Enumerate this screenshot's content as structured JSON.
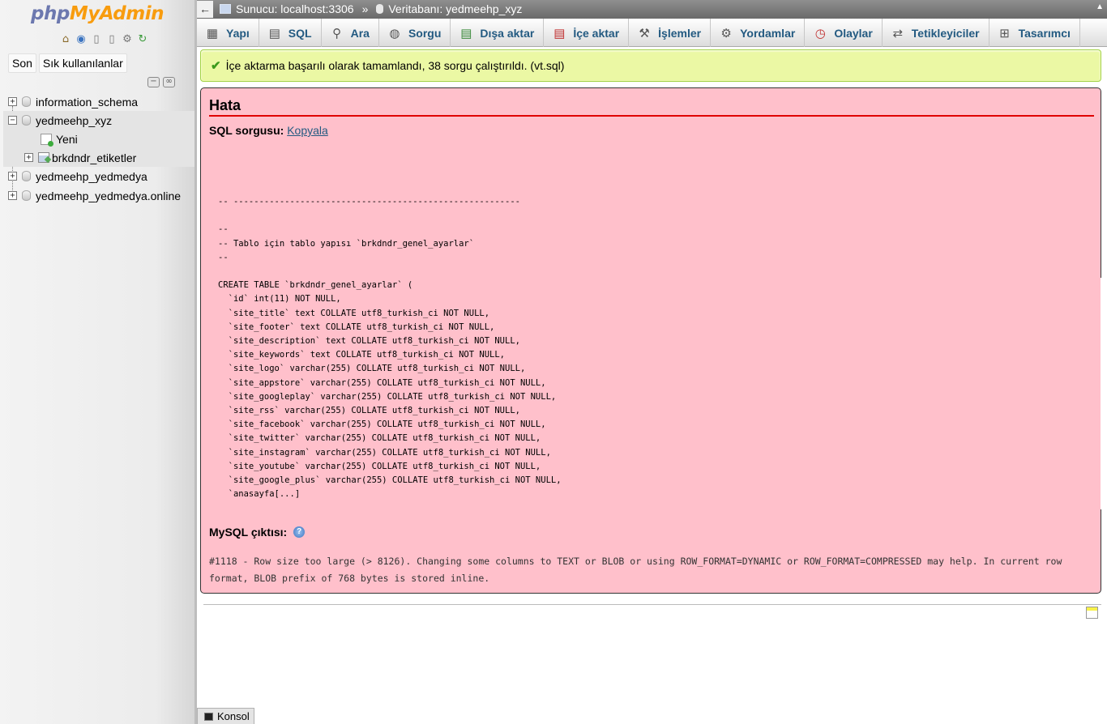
{
  "app": {
    "logo_left": "php",
    "logo_right": "MyAdmin"
  },
  "nav": {
    "tabs": [
      "Son",
      "Sık kullanılanlar"
    ],
    "tree": [
      {
        "label": "information_schema",
        "expanded": false
      },
      {
        "label": "yedmeehp_xyz",
        "expanded": true
      },
      {
        "label": "Yeni"
      },
      {
        "label": "brkdndr_etiketler"
      },
      {
        "label": "yedmeehp_yedmedya",
        "expanded": false
      },
      {
        "label": "yedmeehp_yedmedya.online",
        "expanded": false
      }
    ]
  },
  "breadcrumb": {
    "server": "Sunucu: localhost:3306",
    "separator": "»",
    "database": "Veritabanı: yedmeehp_xyz"
  },
  "menu": {
    "tabs": [
      {
        "label": "Yapı",
        "icon": "structure-icon"
      },
      {
        "label": "SQL",
        "icon": "sql-icon"
      },
      {
        "label": "Ara",
        "icon": "search-icon"
      },
      {
        "label": "Sorgu",
        "icon": "query-icon"
      },
      {
        "label": "Dışa aktar",
        "icon": "export-icon"
      },
      {
        "label": "İçe aktar",
        "icon": "import-icon"
      },
      {
        "label": "İşlemler",
        "icon": "wrench-icon"
      },
      {
        "label": "Yordamlar",
        "icon": "routines-icon"
      },
      {
        "label": "Olaylar",
        "icon": "clock-icon"
      },
      {
        "label": "Tetikleyiciler",
        "icon": "triggers-icon"
      },
      {
        "label": "Tasarımcı",
        "icon": "designer-icon"
      }
    ]
  },
  "success": {
    "message": "İçe aktarma başarılı olarak tamamlandı, 38 sorgu çalıştırıldı. (vt.sql)"
  },
  "error": {
    "title": "Hata",
    "sql_label": "SQL sorgusu:",
    "copy_link": "Kopyala",
    "sql_lines": [
      "-- --------------------------------------------------------",
      "",
      "--",
      "-- Tablo için tablo yapısı `brkdndr_genel_ayarlar`",
      "--",
      "",
      "CREATE TABLE `brkdndr_genel_ayarlar` (",
      "  `id` int(11) NOT NULL,",
      "  `site_title` text COLLATE utf8_turkish_ci NOT NULL,",
      "  `site_footer` text COLLATE utf8_turkish_ci NOT NULL,",
      "  `site_description` text COLLATE utf8_turkish_ci NOT NULL,",
      "  `site_keywords` text COLLATE utf8_turkish_ci NOT NULL,",
      "  `site_logo` varchar(255) COLLATE utf8_turkish_ci NOT NULL,",
      "  `site_appstore` varchar(255) COLLATE utf8_turkish_ci NOT NULL,",
      "  `site_googleplay` varchar(255) COLLATE utf8_turkish_ci NOT NULL,",
      "  `site_rss` varchar(255) COLLATE utf8_turkish_ci NOT NULL,",
      "  `site_facebook` varchar(255) COLLATE utf8_turkish_ci NOT NULL,",
      "  `site_twitter` varchar(255) COLLATE utf8_turkish_ci NOT NULL,",
      "  `site_instagram` varchar(255) COLLATE utf8_turkish_ci NOT NULL,",
      "  `site_youtube` varchar(255) COLLATE utf8_turkish_ci NOT NULL,",
      "  `site_google_plus` varchar(255) COLLATE utf8_turkish_ci NOT NULL,",
      "  `anasayfa[...]"
    ],
    "mysql_output_label": "MySQL çıktısı:",
    "mysql_message": "#1118 - Row size too large (> 8126). Changing some columns to TEXT or BLOB or using ROW_FORMAT=DYNAMIC or ROW_FORMAT=COMPRESSED may help. In current row format, BLOB prefix of 768 bytes is stored inline."
  },
  "console": {
    "label": "Konsol"
  },
  "colors": {
    "success_bg": "#ebf8a4",
    "error_bg": "#ffc0cb",
    "error_rule": "#e00000",
    "link": "#235a81",
    "logo_left": "#6c78af",
    "logo_right": "#f89c0e"
  }
}
